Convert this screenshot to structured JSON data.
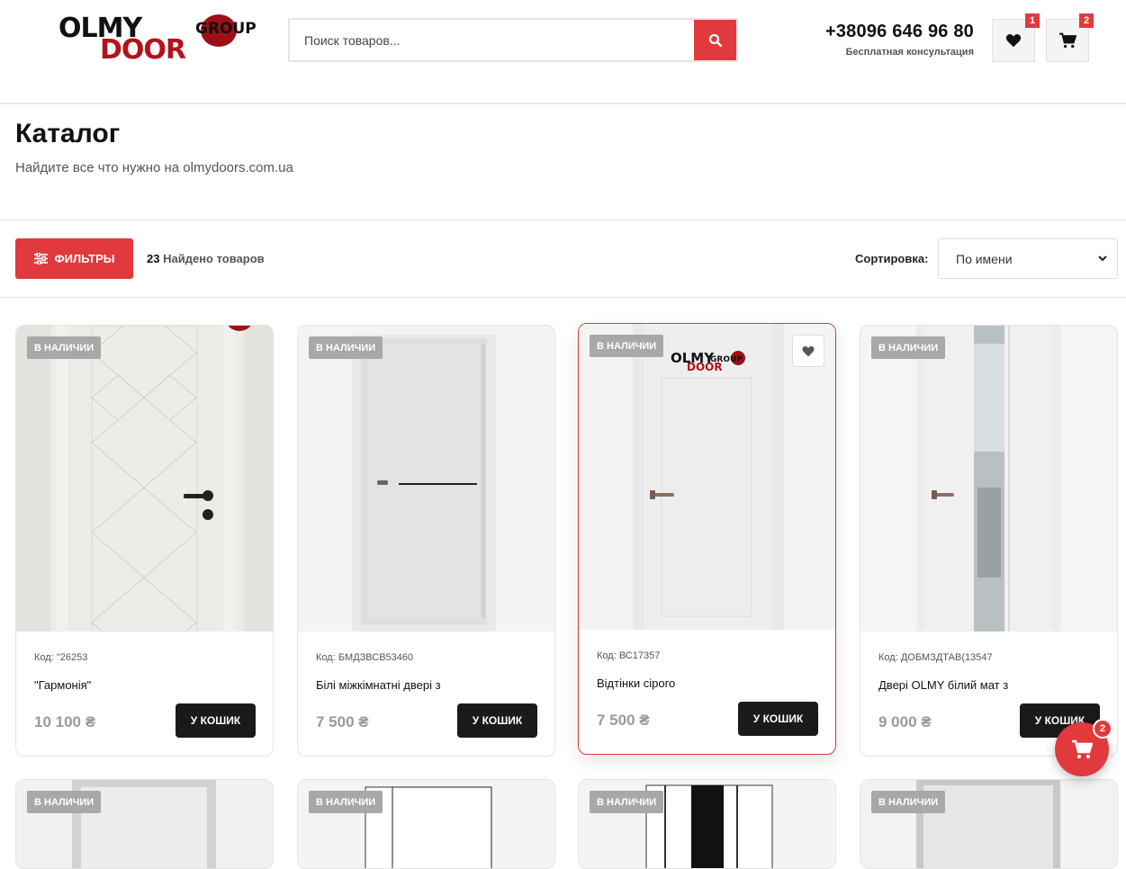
{
  "header": {
    "logo_text_line1": "OLMY",
    "logo_text_group": "GROUP",
    "logo_text_line2": "DOOR",
    "search_placeholder": "Поиск товаров...",
    "phone": "+38096 646 96 80",
    "phone_caption": "Бесплатная консультация",
    "wishlist_count": "1",
    "cart_count": "2"
  },
  "page": {
    "title": "Каталог",
    "subtitle": "Найдите все что нужно на olmydoors.com.ua"
  },
  "toolbar": {
    "filters_label": "ФИЛЬТРЫ",
    "found_count": "23",
    "found_label": "Найдено товаров",
    "sort_label": "Сортировка:",
    "sort_value": "По имени"
  },
  "products": [
    {
      "stock": "В НАЛИЧИИ",
      "code": "Код: \"26253",
      "name": "\"Гармонія\"",
      "price": "10 100 ₴",
      "cart_label": "У КОШИК"
    },
    {
      "stock": "В НАЛИЧИИ",
      "code": "Код: БМДЗВСВ53460",
      "name": "Білі міжкімнатні двері з",
      "price": "7 500 ₴",
      "cart_label": "У КОШИК"
    },
    {
      "stock": "В НАЛИЧИИ",
      "code": "Код: ВС17357",
      "name": "Відтінки сірого",
      "price": "7 500 ₴",
      "cart_label": "У КОШИК"
    },
    {
      "stock": "В НАЛИЧИИ",
      "code": "Код: ДОБМЗДТАВ(13547",
      "name": "Двері OLMY білий мат з",
      "price": "9 000 ₴",
      "cart_label": "У КОШИК"
    }
  ],
  "row2_stock": "В НАЛИЧИИ",
  "float_cart_count": "2",
  "colors": {
    "accent": "#e1393d",
    "dark": "#1a1a1a",
    "stock_badge": "#a8a8a8"
  }
}
